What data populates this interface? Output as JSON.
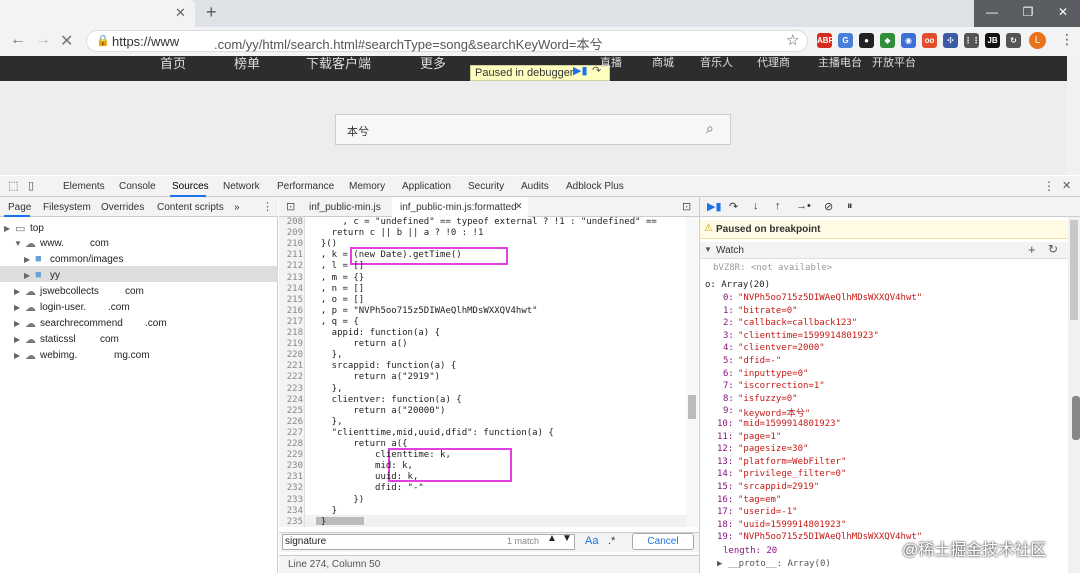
{
  "browser": {
    "url_prefix": "https://www",
    "url_rest": ".com/yy/html/search.html#searchType=song&searchKeyWord=本兮",
    "window_controls": {
      "minimize": "—",
      "maximize": "❐",
      "close": "✕"
    },
    "extensions": [
      {
        "name": "abp-icon",
        "label": "ABP",
        "color": "#d52b1e"
      },
      {
        "name": "translate-icon",
        "label": "G",
        "color": "#4a7fd9"
      },
      {
        "name": "ghost-icon",
        "label": "●",
        "color": "#222222"
      },
      {
        "name": "puzzle-icon",
        "label": "◆",
        "color": "#2f8f3a"
      },
      {
        "name": "toggle-icon",
        "label": "◉",
        "color": "#3d6fd8"
      },
      {
        "name": "rec-icon",
        "label": "oo",
        "color": "#e24e2b"
      },
      {
        "name": "pin-icon",
        "label": "✣",
        "color": "#3b5ba5"
      },
      {
        "name": "dots-icon",
        "label": "⋮⋮",
        "color": "#555555"
      },
      {
        "name": "jb-icon",
        "label": "JB",
        "color": "#111111"
      },
      {
        "name": "refresh-ext-icon",
        "label": "↻",
        "color": "#555555"
      }
    ],
    "profile_initial": "L"
  },
  "page": {
    "nav": [
      "首页",
      "榜单",
      "下载客户端",
      "更多",
      "直播",
      "商城",
      "音乐人",
      "代理商",
      "主播电台",
      "开放平台"
    ],
    "paused_label": "Paused in debugger",
    "search_value": "本兮"
  },
  "devtools": {
    "tabs": [
      "Elements",
      "Console",
      "Sources",
      "Network",
      "Performance",
      "Memory",
      "Application",
      "Security",
      "Audits",
      "Adblock Plus"
    ],
    "left_tabs": [
      "Page",
      "Filesystem",
      "Overrides",
      "Content scripts",
      "»"
    ],
    "tree": [
      {
        "label": "top",
        "indent": 0,
        "kind": "frame"
      },
      {
        "label": "www.",
        "suffix": "com",
        "indent": 1,
        "kind": "cloud"
      },
      {
        "label": "common/images",
        "indent": 2,
        "kind": "folder"
      },
      {
        "label": "yy",
        "indent": 2,
        "kind": "folder",
        "selected": true
      },
      {
        "label": "jswebcollects",
        "suffix": "com",
        "indent": 1,
        "kind": "cloud"
      },
      {
        "label": "login-user.",
        "suffix": ".com",
        "indent": 1,
        "kind": "cloud"
      },
      {
        "label": "searchrecommend",
        "suffix": ".com",
        "indent": 1,
        "kind": "cloud"
      },
      {
        "label": "staticssl",
        "suffix": "com",
        "indent": 1,
        "kind": "cloud"
      },
      {
        "label": "webimg.",
        "suffix": "mg.com",
        "indent": 1,
        "kind": "cloud"
      }
    ],
    "editor_tabs": [
      "inf_public-min.js",
      "inf_public-min.js:formatted"
    ],
    "code_lines": [
      {
        "n": "208",
        "t": "      , c = \"undefined\" == typeof external ? !1 : \"undefined\" =="
      },
      {
        "n": "209",
        "t": "    return c || b || a ? !0 : !1"
      },
      {
        "n": "210",
        "t": "  }()"
      },
      {
        "n": "211",
        "t": "  , k = (new Date).getTime()"
      },
      {
        "n": "212",
        "t": "  , l = []"
      },
      {
        "n": "213",
        "t": "  , m = {}"
      },
      {
        "n": "214",
        "t": "  , n = []"
      },
      {
        "n": "215",
        "t": "  , o = []"
      },
      {
        "n": "216",
        "t": "  , p = \"NVPh5oo715z5DIWAeQlhMDsWXXQV4hwt\""
      },
      {
        "n": "217",
        "t": "  , q = {"
      },
      {
        "n": "218",
        "t": "    appid: function(a) {"
      },
      {
        "n": "219",
        "t": "        return a()"
      },
      {
        "n": "220",
        "t": "    },"
      },
      {
        "n": "221",
        "t": "    srcappid: function(a) {"
      },
      {
        "n": "222",
        "t": "        return a(\"2919\")"
      },
      {
        "n": "223",
        "t": "    },"
      },
      {
        "n": "224",
        "t": "    clientver: function(a) {"
      },
      {
        "n": "225",
        "t": "        return a(\"20000\")"
      },
      {
        "n": "226",
        "t": "    },"
      },
      {
        "n": "227",
        "t": "    \"clienttime,mid,uuid,dfid\": function(a) {"
      },
      {
        "n": "228",
        "t": "        return a({"
      },
      {
        "n": "229",
        "t": "            clienttime: k,"
      },
      {
        "n": "230",
        "t": "            mid: k,"
      },
      {
        "n": "231",
        "t": "            uuid: k,"
      },
      {
        "n": "232",
        "t": "            dfid: \"-\""
      },
      {
        "n": "233",
        "t": "        })"
      },
      {
        "n": "234",
        "t": "    }"
      },
      {
        "n": "235",
        "t": "  }"
      }
    ],
    "search": {
      "value": "signature",
      "match": "1 match",
      "aa": "Aa",
      "regex": ".*",
      "cancel": "Cancel"
    },
    "status": "Line 274, Column 50",
    "breakpoint_banner": "Paused on breakpoint",
    "watch_title": "Watch",
    "watch": {
      "first": "bVZ8R: <not available>",
      "array_label": "o: Array(20)",
      "items": [
        "\"NVPh5oo715z5DIWAeQlhMDsWXXQV4hwt\"",
        "\"bitrate=0\"",
        "\"callback=callback123\"",
        "\"clienttime=1599914801923\"",
        "\"clientver=2000\"",
        "\"dfid=-\"",
        "\"inputtype=0\"",
        "\"iscorrection=1\"",
        "\"isfuzzy=0\"",
        "\"keyword=本兮\"",
        "\"mid=1599914801923\"",
        "\"page=1\"",
        "\"pagesize=30\"",
        "\"platform=WebFilter\"",
        "\"privilege_filter=0\"",
        "\"srcappid=2919\"",
        "\"tag=em\"",
        "\"userid=-1\"",
        "\"uuid=1599914801923\"",
        "\"NVPh5oo715z5DIWAeQlhMDsWXXQV4hwt\""
      ],
      "length": "length: 20",
      "proto": "▶ __proto__: Array(0)"
    },
    "watermark": "@稀土掘金技术社区"
  }
}
